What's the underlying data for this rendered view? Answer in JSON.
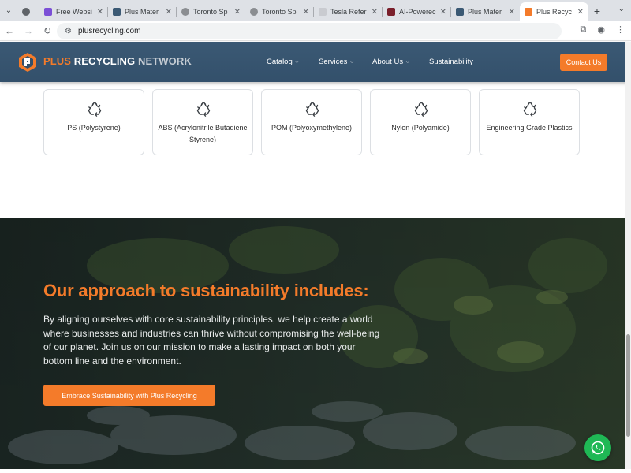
{
  "browser": {
    "tabs": [
      {
        "title": "",
        "favicon_color": "#5f6368"
      },
      {
        "title": "Free Websi",
        "favicon_color": "#7b4fd6"
      },
      {
        "title": "Plus Mater",
        "favicon_color": "#3b5974"
      },
      {
        "title": "Toronto Sp",
        "favicon_color": "#8a8d91"
      },
      {
        "title": "Toronto Sp",
        "favicon_color": "#8a8d91"
      },
      {
        "title": "Tesla Refer",
        "favicon_color": "#c9cbd0"
      },
      {
        "title": "AI-Powerec",
        "favicon_color": "#7a1f2b"
      },
      {
        "title": "Plus Mater",
        "favicon_color": "#3b5974"
      },
      {
        "title": "Plus Recyc",
        "favicon_color": "#f47b2a"
      }
    ],
    "close_glyph": "✕",
    "new_tab_glyph": "+",
    "url": "plusrecycling.com"
  },
  "header": {
    "brand_part1": "PLUS",
    "brand_part2": " RECYCLING",
    "brand_part3": " NETWORK",
    "nav": [
      {
        "label": "Catalog",
        "has_dropdown": true
      },
      {
        "label": "Services",
        "has_dropdown": true
      },
      {
        "label": "About Us",
        "has_dropdown": true
      },
      {
        "label": "Sustainability",
        "has_dropdown": false
      }
    ],
    "contact_label": "Contact Us"
  },
  "materials": [
    {
      "label": "PS (Polystyrene)"
    },
    {
      "label": "ABS (Acrylonitrile Butadiene Styrene)"
    },
    {
      "label": "POM (Polyoxymethylene)"
    },
    {
      "label": "Nylon (Polyamide)"
    },
    {
      "label": "Engineering Grade Plastics"
    }
  ],
  "hero": {
    "title": "Our approach to sustainability includes:",
    "body": "By aligning ourselves with core sustainability principles, we help create a world where businesses and industries can thrive without compromising the well-being of our planet. Join us on our mission to make a lasting impact on both your bottom line and the environment.",
    "cta_label": "Embrace Sustainability with Plus Recycling"
  },
  "colors": {
    "accent": "#f47b2a",
    "header_bg": "#3b5974",
    "whatsapp": "#1fb855"
  }
}
